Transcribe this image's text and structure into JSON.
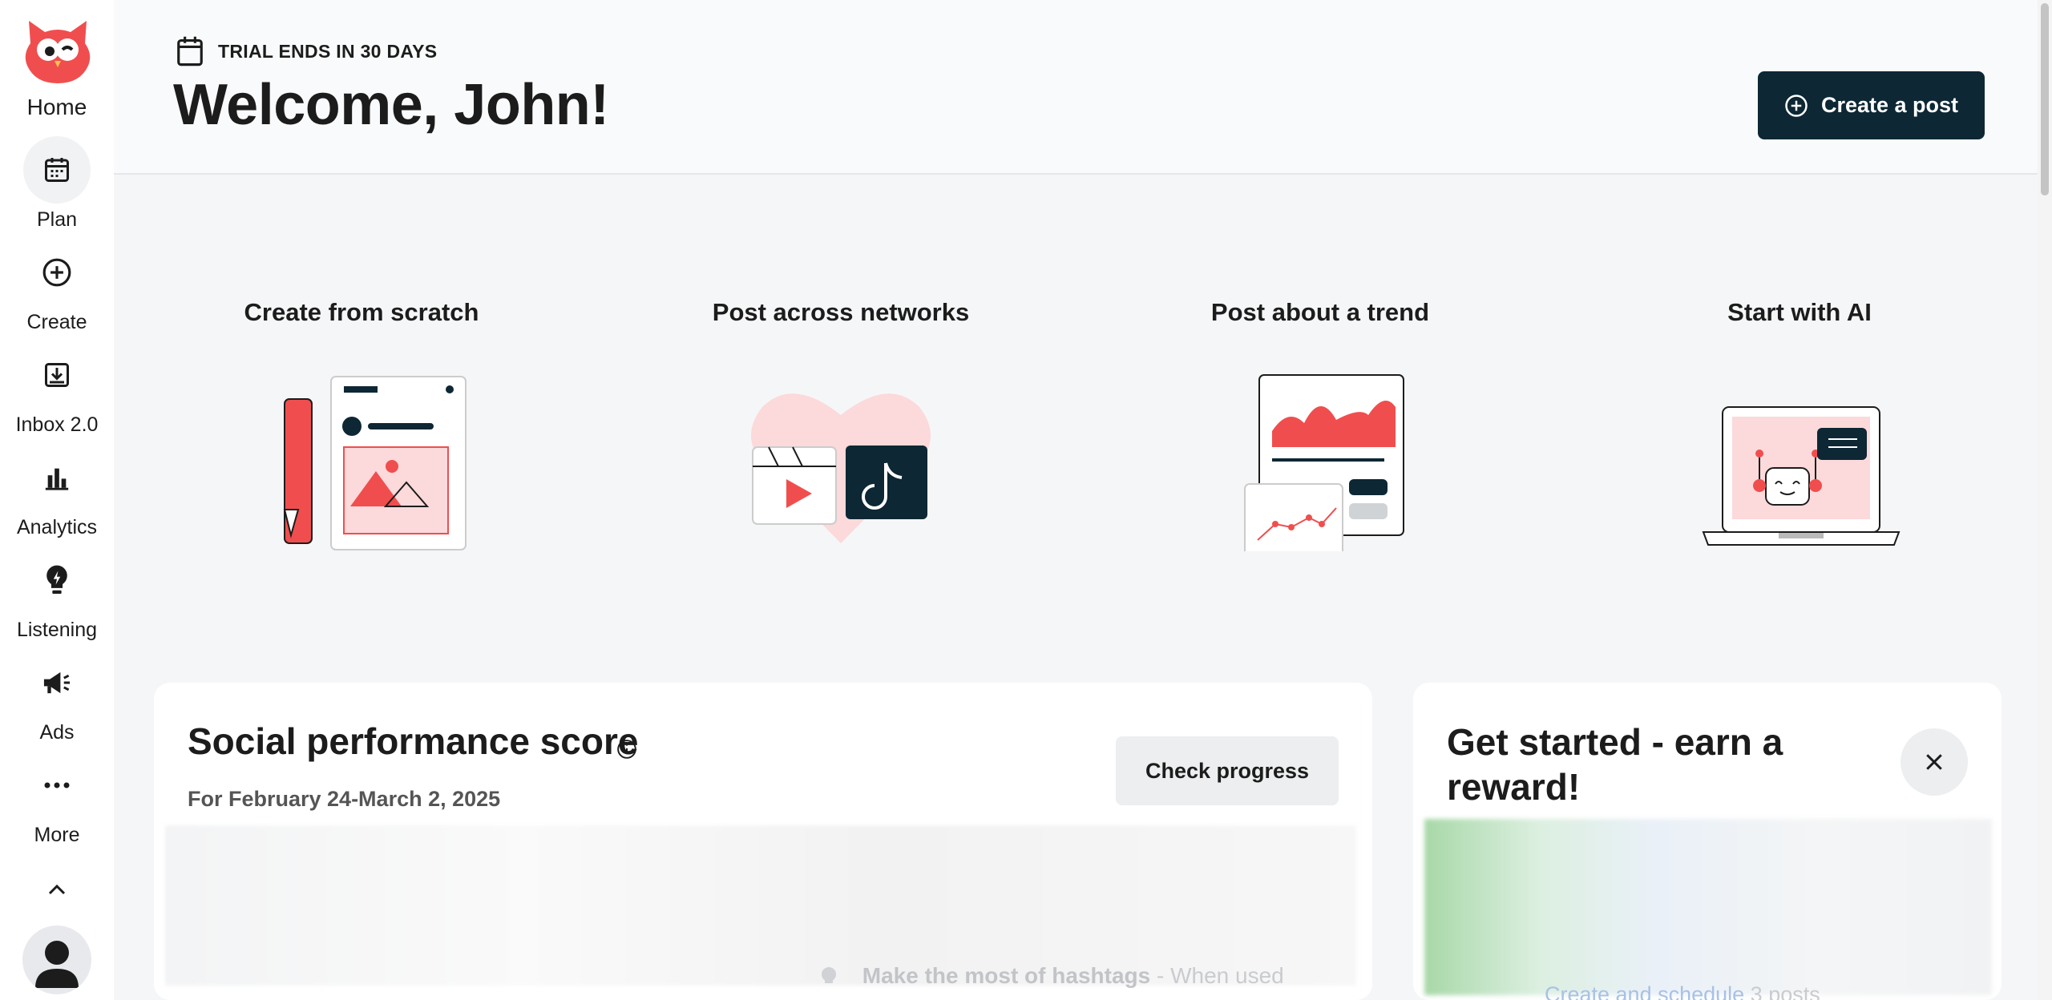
{
  "sidebar": {
    "items": [
      {
        "label": "Home",
        "icon": "owl-logo"
      },
      {
        "label": "Plan",
        "icon": "calendar-icon"
      },
      {
        "label": "Create",
        "icon": "plus-circle-icon"
      },
      {
        "label": "Inbox 2.0",
        "icon": "inbox-icon"
      },
      {
        "label": "Analytics",
        "icon": "bar-chart-icon"
      },
      {
        "label": "Listening",
        "icon": "lightbulb-icon"
      },
      {
        "label": "Ads",
        "icon": "megaphone-icon"
      },
      {
        "label": "More",
        "icon": "ellipsis-icon"
      }
    ],
    "collapse_icon": "chevron-up-icon",
    "avatar_icon": "user-avatar-icon"
  },
  "header": {
    "trial": "TRIAL ENDS IN 30 DAYS",
    "welcome": "Welcome, John!",
    "create_post": "Create a post"
  },
  "quick_start": [
    {
      "title": "Create from scratch"
    },
    {
      "title": "Post across networks"
    },
    {
      "title": "Post about a trend"
    },
    {
      "title": "Start with AI"
    }
  ],
  "score_panel": {
    "title": "Social performance score",
    "date": "For February 24-March 2, 2025",
    "check_progress": "Check progress",
    "tip_bold": "Make the most of hashtags",
    "tip_rest": " - When used"
  },
  "reward_panel": {
    "title": "Get started - earn a reward!",
    "link": "Create and schedule",
    "link_rest": " 3 posts"
  },
  "colors": {
    "brand_red": "#f04e4e",
    "dark_navy": "#0d2734",
    "pink": "#fcd9da"
  }
}
